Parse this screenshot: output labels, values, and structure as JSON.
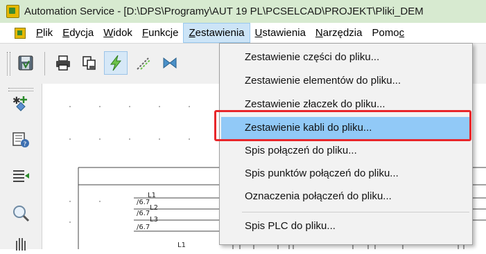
{
  "window": {
    "title": "Automation Service - [D:\\DPS\\Programy\\AUT 19 PL\\PCSELCAD\\PROJEKT\\Pliki_DEM"
  },
  "menubar": {
    "items": [
      {
        "label_u": "P",
        "label_rest": "lik"
      },
      {
        "label_u": "E",
        "label_rest": "dycja"
      },
      {
        "label_u": "W",
        "label_rest": "idok"
      },
      {
        "label_u": "F",
        "label_rest": "unkcje"
      },
      {
        "label_u": "Z",
        "label_rest": "estawienia"
      },
      {
        "label_u": "U",
        "label_rest": "stawienia"
      },
      {
        "label_u": "N",
        "label_rest": "arzędzia"
      },
      {
        "label_pre": "Pomo",
        "label_u": "c",
        "label_rest": ""
      }
    ],
    "active_index": 4
  },
  "toolbar": {
    "icons": [
      "save-icon",
      "print-icon",
      "copy-icon",
      "lightning-icon",
      "pencil-icon",
      "bowtie-icon"
    ]
  },
  "leftbar": {
    "icons": [
      "add-symbol-icon",
      "library-icon",
      "list-arrow-icon",
      "zoom-icon",
      "hand-icon"
    ]
  },
  "dropdown": {
    "items": [
      "Zestawienie części do pliku...",
      "Zestawienie elementów do pliku...",
      "Zestawienie złaczek do pliku...",
      "Zestawienie kabli do pliku...",
      "Spis połączeń do pliku...",
      "Spis punktów połączeń do pliku...",
      "Oznaczenia połączeń do pliku...",
      "Spis PLC do pliku..."
    ],
    "highlighted_index": 3,
    "highlight_color": "#91c9f7",
    "annotation_color": "#e8262a"
  },
  "canvas": {
    "labels": [
      "L1",
      "L2",
      "L3",
      "/6.7",
      "/6.7",
      "/6.7",
      "L1"
    ]
  }
}
